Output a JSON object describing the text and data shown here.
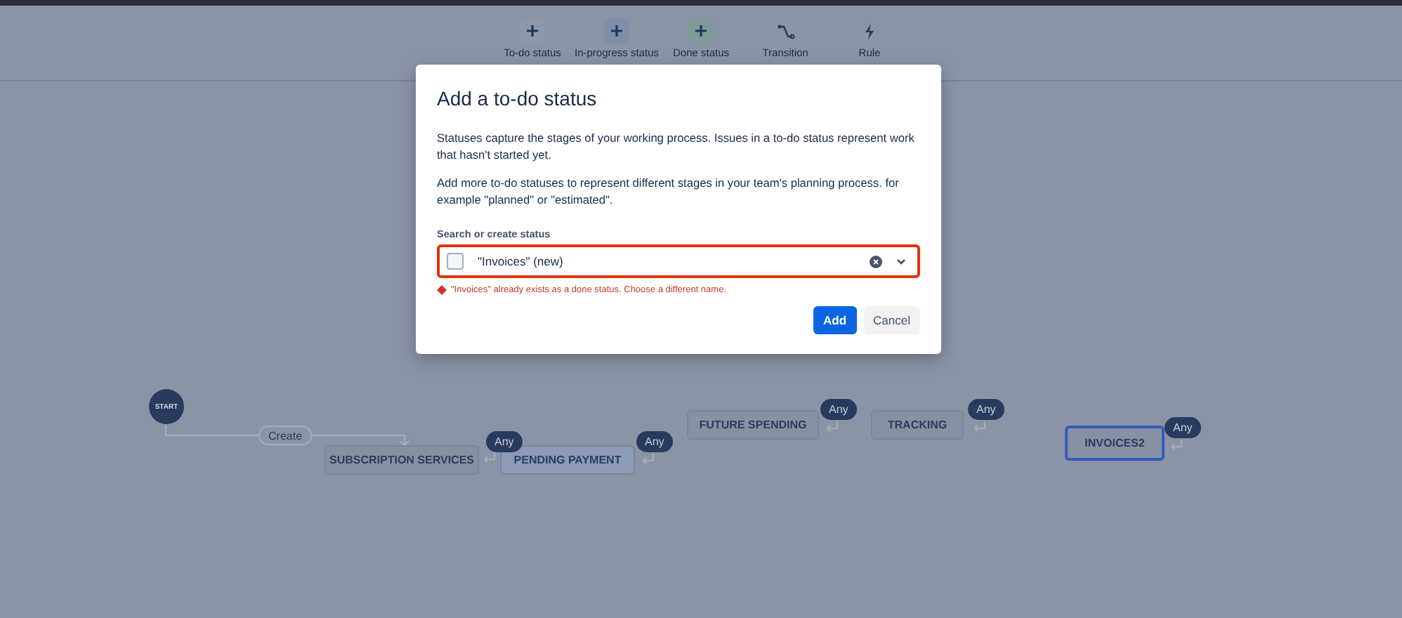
{
  "toolbar": [
    {
      "kind": "plus",
      "label": "To-do status",
      "color": "#8e97a8"
    },
    {
      "kind": "plus",
      "label": "In-progress status",
      "color": "#7f8fab"
    },
    {
      "kind": "plus",
      "label": "Done status",
      "color": "#7f9a9a"
    },
    {
      "kind": "transition",
      "label": "Transition"
    },
    {
      "kind": "rule",
      "label": "Rule"
    }
  ],
  "workflow": {
    "start": "START",
    "create": "Create",
    "statuses": [
      {
        "label": "SUBSCRIPTION SERVICES",
        "selected": false,
        "highlighted": false
      },
      {
        "label": "PENDING PAYMENT",
        "selected": false,
        "highlighted": true,
        "any": "Any"
      },
      {
        "label": "FUTURE SPENDING",
        "selected": false,
        "highlighted": false,
        "any": "Any"
      },
      {
        "label": "TRACKING",
        "selected": false,
        "highlighted": false,
        "any": "Any"
      },
      {
        "label": "INVOICES2",
        "selected": true,
        "highlighted": false,
        "any": "Any"
      }
    ],
    "sub_any": "Any"
  },
  "dialog": {
    "title": "Add a to-do status",
    "paragraphs": [
      "Statuses capture the stages of your working process. Issues in a to-do status represent work that hasn't started yet.",
      "Add more to-do statuses to represent different stages in your team's planning process. for example \"planned\" or \"estimated\"."
    ],
    "field_label": "Search or create status",
    "field_value": "\"Invoices\" (new)",
    "checked": false,
    "error": "\"Invoices\" already exists as a done status. Choose a different name.",
    "buttons": [
      {
        "label": "Add",
        "kind": "primary"
      },
      {
        "label": "Cancel",
        "kind": "secondary"
      }
    ]
  }
}
